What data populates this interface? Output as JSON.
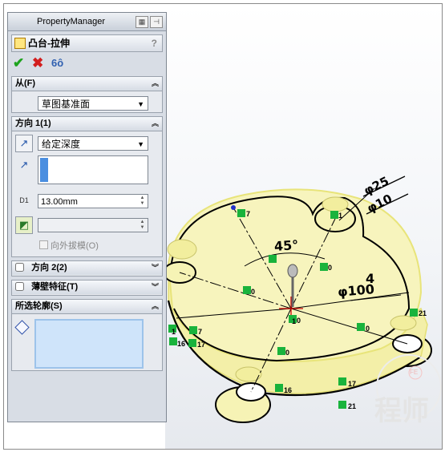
{
  "property_manager": {
    "title": "PropertyManager",
    "feature_name": "凸台-拉伸",
    "help_glyph": "?",
    "confirm_glyph": "✔",
    "cancel_glyph": "✖",
    "preview_glyph": "6ô"
  },
  "from_group": {
    "label": "从(F)",
    "selected": "草图基准面"
  },
  "direction1_group": {
    "label": "方向 1(1)",
    "end_condition": "给定深度",
    "depth_value": "13.00mm",
    "depth_icon_label": "D1",
    "draft_outward_label": "向外拔模(O)"
  },
  "direction2_group": {
    "label": "方向 2(2)"
  },
  "thin_feature_group": {
    "label": "薄壁特征(T)"
  },
  "selected_contours_group": {
    "label": "所选轮廓(S)"
  },
  "sketch_annotations": {
    "dim_angle": "45°",
    "dim_depth": "4",
    "dim_dia_large": "φ100",
    "dim_dia_boss": "φ25",
    "dim_dia_hole": "φ10",
    "relation_labels": [
      "7",
      "1",
      "0",
      "0",
      "0",
      "0",
      "0",
      "21",
      "7",
      "17",
      "16",
      "17",
      "16",
      "21",
      "1",
      "1"
    ]
  },
  "watermark": {
    "text": "程师",
    "seal_text": "FE"
  },
  "colors": {
    "part_fill": "#f6f3b5",
    "part_edge": "#e8e47a",
    "sketch_line": "#000000",
    "relation_marker": "#19b33c",
    "panel_bg": "#d8dde5"
  }
}
